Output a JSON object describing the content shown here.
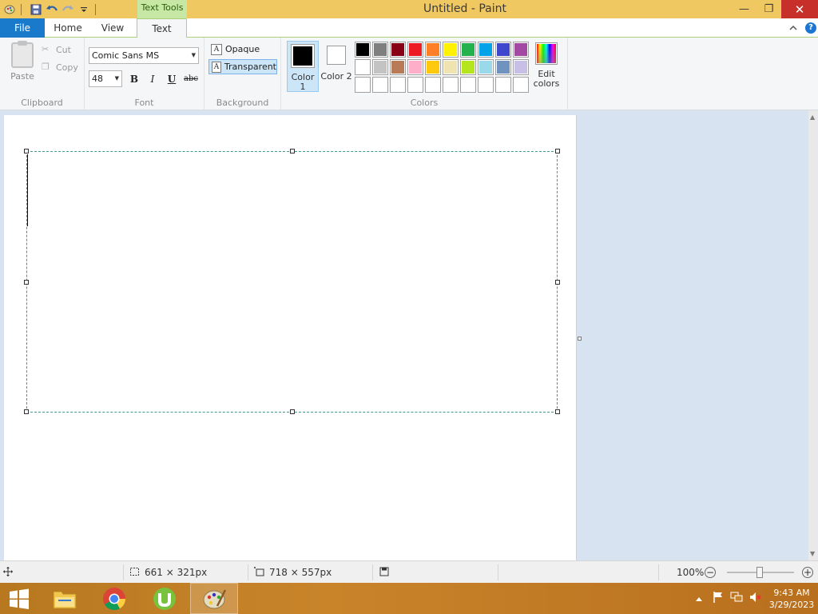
{
  "window": {
    "title": "Untitled - Paint",
    "context_tab_group": "Text Tools",
    "minimize_glyph": "—",
    "maximize_glyph": "❐",
    "close_glyph": "✕"
  },
  "quick_access": {
    "icons": [
      "paint-app-icon",
      "save-icon",
      "undo-icon",
      "redo-icon",
      "customize-qat-icon"
    ]
  },
  "tabs": {
    "file": "File",
    "home": "Home",
    "view": "View",
    "text": "Text",
    "active": "Text"
  },
  "ribbon": {
    "clipboard": {
      "label": "Clipboard",
      "paste": "Paste",
      "cut": "Cut",
      "copy": "Copy"
    },
    "font": {
      "label": "Font",
      "family": "Comic Sans MS",
      "size": "48",
      "bold": "B",
      "italic": "I",
      "underline": "U",
      "strikethrough": "abc"
    },
    "background": {
      "label": "Background",
      "opaque": "Opaque",
      "transparent": "Transparent",
      "selected": "Transparent"
    },
    "colors": {
      "label": "Colors",
      "color1_label": "Color 1",
      "color2_label": "Color 2",
      "color1": "#000000",
      "color2": "#ffffff",
      "edit_colors": "Edit colors",
      "palette": [
        "#000000",
        "#7f7f7f",
        "#880015",
        "#ed1c24",
        "#ff7f27",
        "#fff200",
        "#22b14c",
        "#00a2e8",
        "#3f48cc",
        "#a349a4",
        "#ffffff",
        "#c3c3c3",
        "#b97a57",
        "#ffaec9",
        "#ffc90e",
        "#efe4b0",
        "#b5e61d",
        "#99d9ea",
        "#7092be",
        "#c8bfe7",
        "",
        "",
        "",
        "",
        "",
        "",
        "",
        "",
        "",
        ""
      ]
    }
  },
  "status": {
    "selection_size": "661 × 321px",
    "canvas_size": "718 × 557px",
    "zoom": "100%"
  },
  "taskbar": {
    "apps": [
      "start-button",
      "file-explorer",
      "chrome",
      "utorrent",
      "paint"
    ],
    "active_app": "paint",
    "time": "9:43 AM",
    "date": "3/29/2023"
  }
}
